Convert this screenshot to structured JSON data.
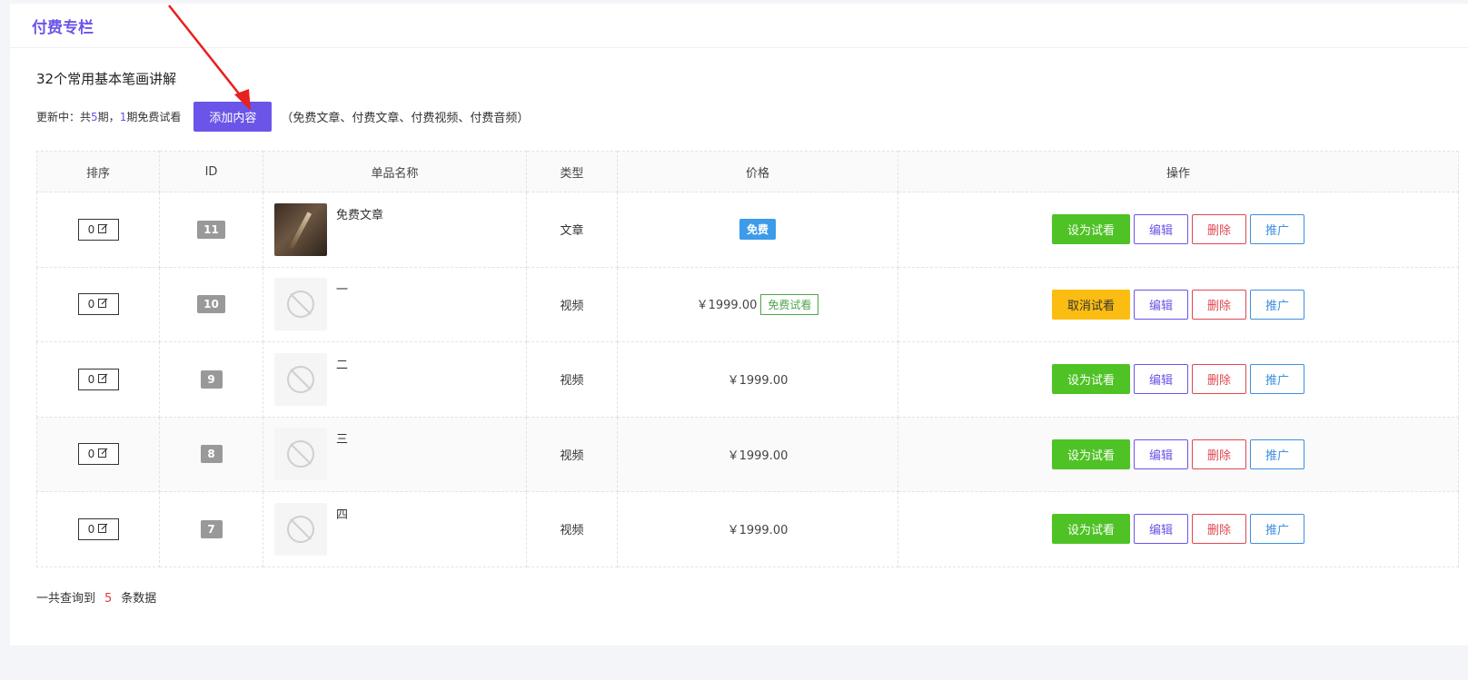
{
  "header": {
    "title": "付费专栏"
  },
  "column": {
    "title": "32个常用基本笔画讲解",
    "status_prefix": "更新中：",
    "total_prefix": "共",
    "total_count": "5",
    "total_suffix": "期，",
    "free_count": "1",
    "free_suffix": "期免费试看",
    "add_button": "添加内容",
    "add_hint": "（免费文章、付费文章、付费视频、付费音频）"
  },
  "table": {
    "headers": [
      "排序",
      "ID",
      "单品名称",
      "类型",
      "价格",
      "操作"
    ],
    "rows": [
      {
        "sort": "0",
        "id": "11",
        "name": "免费文章",
        "type": "文章",
        "price": "",
        "price_tag": "免费",
        "trial_tag": "",
        "trial_button": "设为试看",
        "thumb": "photo"
      },
      {
        "sort": "0",
        "id": "10",
        "name": "一",
        "type": "视频",
        "price": "￥1999.00",
        "price_tag": "",
        "trial_tag": "免费试看",
        "trial_button": "取消试看",
        "thumb": "none"
      },
      {
        "sort": "0",
        "id": "9",
        "name": "二",
        "type": "视频",
        "price": "￥1999.00",
        "price_tag": "",
        "trial_tag": "",
        "trial_button": "设为试看",
        "thumb": "none"
      },
      {
        "sort": "0",
        "id": "8",
        "name": "三",
        "type": "视频",
        "price": "￥1999.00",
        "price_tag": "",
        "trial_tag": "",
        "trial_button": "设为试看",
        "thumb": "none"
      },
      {
        "sort": "0",
        "id": "7",
        "name": "四",
        "type": "视频",
        "price": "￥1999.00",
        "price_tag": "",
        "trial_tag": "",
        "trial_button": "设为试看",
        "thumb": "none"
      }
    ],
    "edit_label": "编辑",
    "delete_label": "删除",
    "promote_label": "推广"
  },
  "footer": {
    "prefix": "一共查询到",
    "count": "5",
    "suffix": "条数据"
  },
  "colors": {
    "accent": "#6a55e8",
    "trial_green": "#4fc226",
    "cancel_yellow": "#fbbd11",
    "danger": "#e0474f",
    "info": "#3d8fe0"
  }
}
